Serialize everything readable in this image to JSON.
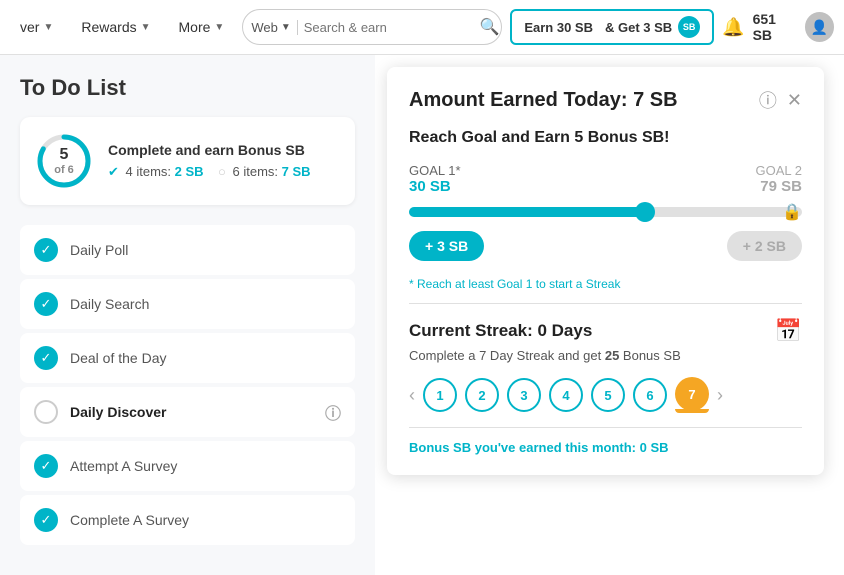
{
  "nav": {
    "discover_label": "ver",
    "rewards_label": "Rewards",
    "more_label": "More",
    "search_type": "Web",
    "search_placeholder": "Search & earn",
    "earn_line1": "Earn 30 SB",
    "earn_line2": "& Get 3 SB",
    "sb_badge": "SB",
    "notif_icon": "🔔",
    "balance": "651 SB",
    "avatar_icon": "👤"
  },
  "todo": {
    "title": "To Do List",
    "progress_num": "5",
    "progress_denom": "of 6",
    "bonus_title": "Complete and earn Bonus SB",
    "items_4_label": "4 items:",
    "items_4_sb": "2 SB",
    "items_6_label": "6 items:",
    "items_6_sb": "7 SB",
    "items": [
      {
        "label": "Daily Poll",
        "completed": true
      },
      {
        "label": "Daily Search",
        "completed": true
      },
      {
        "label": "Deal of the Day",
        "completed": true
      },
      {
        "label": "Daily Discover",
        "completed": false
      },
      {
        "label": "Attempt A Survey",
        "completed": true
      },
      {
        "label": "Complete A Survey",
        "completed": true
      }
    ]
  },
  "card": {
    "amount_title": "Amount Earned Today: 7 SB",
    "reach_goal": "Reach Goal and Earn 5 Bonus SB!",
    "goal1_label": "GOAL 1*",
    "goal1_val": "30 SB",
    "goal2_label": "GOAL 2",
    "goal2_val": "79 SB",
    "bonus1": "+ 3 SB",
    "bonus2": "+ 2 SB",
    "progress_pct": 60,
    "streak_note": "* Reach at least Goal 1 to start a Streak",
    "streak_title": "Current Streak: 0 Days",
    "streak_sub_prefix": "Complete a 7 Day Streak and get ",
    "streak_bold": "25",
    "streak_sub_suffix": " Bonus SB",
    "days": [
      "1",
      "2",
      "3",
      "4",
      "5",
      "6",
      "7"
    ],
    "active_day": "7",
    "bonus_month_label": "Bonus SB you've earned this month:",
    "bonus_month_val": "0 SB"
  }
}
